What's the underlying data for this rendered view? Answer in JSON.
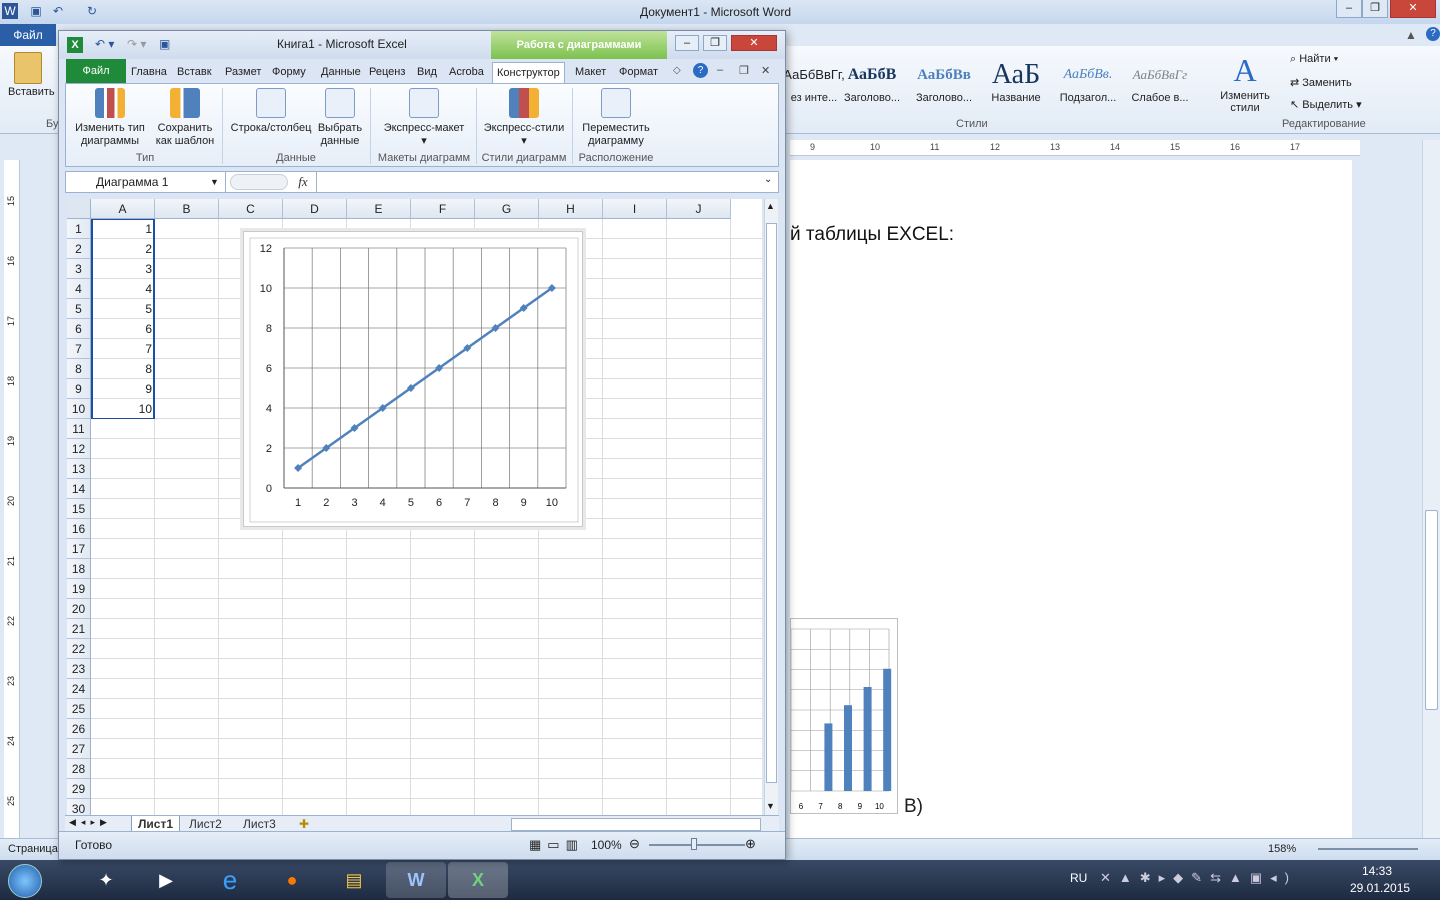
{
  "word": {
    "title": "Документ1 - Microsoft Word",
    "file_tab": "Файл",
    "paste_label": "Вставить",
    "clipboard_group_fragment": "Бу",
    "styles": [
      {
        "sample": "АаБбВвГг,",
        "label": "ез инте..."
      },
      {
        "sample": "АаБбВ",
        "label": "Заголово..."
      },
      {
        "sample": "АаБбВв",
        "label": "Заголово..."
      },
      {
        "sample": "АаБ",
        "label": "Название"
      },
      {
        "sample": "АаБбВв.",
        "label": "Подзагол..."
      },
      {
        "sample": "АаБбВвГг",
        "label": "Слабое в..."
      }
    ],
    "change_styles": "Изменить стили",
    "styles_group": "Стили",
    "editing": {
      "find": "Найти",
      "replace": "Заменить",
      "select": "Выделить",
      "group": "Редактирование"
    },
    "ruler_numbers": [
      "9",
      "10",
      "11",
      "12",
      "13",
      "14",
      "15",
      "16",
      "17"
    ],
    "vruler_numbers": [
      "15",
      "16",
      "17",
      "18",
      "19",
      "20",
      "21",
      "22",
      "23",
      "24",
      "25"
    ],
    "doc_text": "й таблицы EXCEL:",
    "doc_text_b": "В)",
    "bar_chart": {
      "x_labels": [
        "6",
        "7",
        "8",
        "9",
        "10"
      ],
      "values": [
        6,
        7,
        8,
        9,
        10
      ]
    },
    "status_left": "Страница",
    "zoom": "158%"
  },
  "excel": {
    "title": "Книга1 - Microsoft Excel",
    "context_tab": "Работа с диаграммами",
    "file_tab": "Файл",
    "tabs": [
      "Главна",
      "Вставк",
      "Размет",
      "Форму",
      "Данные",
      "Реценз",
      "Вид",
      "Acroba",
      "Конструктор",
      "Макет",
      "Формат"
    ],
    "ribbon": {
      "change_type": "Изменить тип диаграммы",
      "save_template": "Сохранить как шаблон",
      "group_type": "Тип",
      "row_col": "Строка/столбец",
      "select_data": "Выбрать данные",
      "group_data": "Данные",
      "express_layout": "Экспресс-макет",
      "group_layouts": "Макеты диаграмм",
      "express_styles": "Экспресс-стили",
      "group_styles": "Стили диаграмм",
      "move_chart": "Переместить диаграмму",
      "group_location": "Расположение"
    },
    "name_box": "Диаграмма 1",
    "fx": "fx",
    "columns": [
      "A",
      "B",
      "C",
      "D",
      "E",
      "F",
      "G",
      "H",
      "I",
      "J"
    ],
    "rows": [
      "1",
      "2",
      "3",
      "4",
      "5",
      "6",
      "7",
      "8",
      "9",
      "10",
      "11",
      "12",
      "13",
      "14",
      "15",
      "16",
      "17",
      "18",
      "19",
      "20",
      "21",
      "22",
      "23",
      "24",
      "25",
      "26",
      "27",
      "28",
      "29",
      "30"
    ],
    "column_a_values": [
      "1",
      "2",
      "3",
      "4",
      "5",
      "6",
      "7",
      "8",
      "9",
      "10"
    ],
    "sheets": [
      "Лист1",
      "Лист2",
      "Лист3"
    ],
    "status": "Готово",
    "zoom": "100%"
  },
  "chart_data": {
    "type": "line",
    "x": [
      1,
      2,
      3,
      4,
      5,
      6,
      7,
      8,
      9,
      10
    ],
    "series": [
      {
        "values": [
          1,
          2,
          3,
          4,
          5,
          6,
          7,
          8,
          9,
          10
        ]
      }
    ],
    "ylim": [
      0,
      12
    ],
    "yticks": [
      0,
      2,
      4,
      6,
      8,
      10,
      12
    ],
    "grid": true,
    "color": "#4f81bd"
  },
  "taskbar": {
    "lang": "RU",
    "time": "14:33",
    "date": "29.01.2015"
  }
}
